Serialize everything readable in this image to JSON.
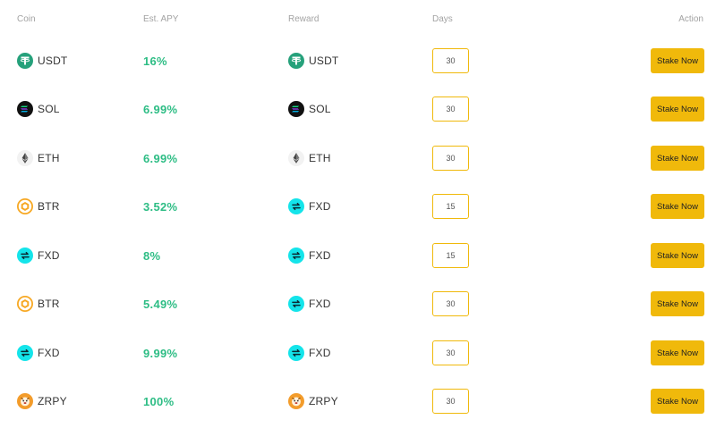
{
  "headers": {
    "coin": "Coin",
    "apy": "Est. APY",
    "reward": "Reward",
    "days": "Days",
    "action": "Action"
  },
  "colors": {
    "apy_green": "#2ebd85",
    "accent_yellow": "#f0b90b",
    "header_gray": "#a3a3a3"
  },
  "rows": [
    {
      "coin": "USDT",
      "coin_icon": "usdt-icon",
      "apy": "16%",
      "reward": "USDT",
      "reward_icon": "usdt-icon",
      "days": "30",
      "action": "Stake Now"
    },
    {
      "coin": "SOL",
      "coin_icon": "sol-icon",
      "apy": "6.99%",
      "reward": "SOL",
      "reward_icon": "sol-icon",
      "days": "30",
      "action": "Stake Now"
    },
    {
      "coin": "ETH",
      "coin_icon": "eth-icon",
      "apy": "6.99%",
      "reward": "ETH",
      "reward_icon": "eth-icon",
      "days": "30",
      "action": "Stake Now"
    },
    {
      "coin": "BTR",
      "coin_icon": "btr-icon",
      "apy": "3.52%",
      "reward": "FXD",
      "reward_icon": "fxd-icon",
      "days": "15",
      "action": "Stake Now"
    },
    {
      "coin": "FXD",
      "coin_icon": "fxd-icon",
      "apy": "8%",
      "reward": "FXD",
      "reward_icon": "fxd-icon",
      "days": "15",
      "action": "Stake Now"
    },
    {
      "coin": "BTR",
      "coin_icon": "btr-icon",
      "apy": "5.49%",
      "reward": "FXD",
      "reward_icon": "fxd-icon",
      "days": "30",
      "action": "Stake Now"
    },
    {
      "coin": "FXD",
      "coin_icon": "fxd-icon",
      "apy": "9.99%",
      "reward": "FXD",
      "reward_icon": "fxd-icon",
      "days": "30",
      "action": "Stake Now"
    },
    {
      "coin": "ZRPY",
      "coin_icon": "zrpy-icon",
      "apy": "100%",
      "reward": "ZRPY",
      "reward_icon": "zrpy-icon",
      "days": "30",
      "action": "Stake Now"
    }
  ]
}
